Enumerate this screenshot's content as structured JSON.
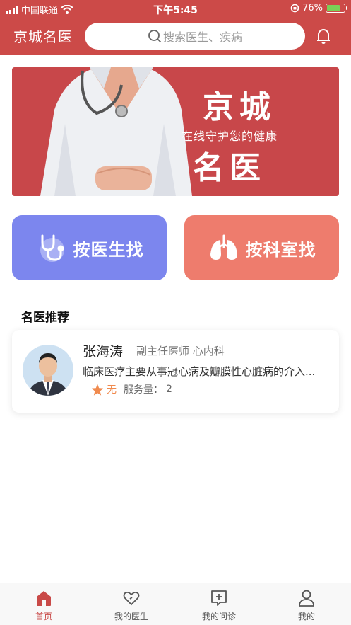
{
  "status_bar": {
    "carrier": "中国联通",
    "time": "下午5:45",
    "battery": "76%"
  },
  "header": {
    "title": "京城名医",
    "search_placeholder": "搜索医生、疾病"
  },
  "banner": {
    "title_line1": "京城",
    "subtitle": "在线守护您的健康",
    "title_line2": "名医"
  },
  "quick_actions": [
    {
      "label": "按医生找",
      "icon": "stethoscope-icon",
      "color": "#7c86ee"
    },
    {
      "label": "按科室找",
      "icon": "lungs-icon",
      "color": "#ee7c6d"
    }
  ],
  "section": {
    "title": "名医推荐"
  },
  "doctor_card": {
    "name": "张海涛",
    "title": "副主任医师 心内科",
    "description": "临床医疗主要从事冠心病及瓣膜性心脏病的介入...",
    "rating": "无",
    "service_label": "服务量：",
    "service_count": "2"
  },
  "tabs": [
    {
      "label": "首页",
      "icon": "home-icon",
      "active": true
    },
    {
      "label": "我的医生",
      "icon": "heart-icon",
      "active": false
    },
    {
      "label": "我的问诊",
      "icon": "consult-icon",
      "active": false
    },
    {
      "label": "我的",
      "icon": "user-icon",
      "active": false
    }
  ],
  "colors": {
    "brand": "#cc4a48",
    "doctor_button": "#7c86ee",
    "department_button": "#ee7c6d",
    "rating": "#f08a4e"
  }
}
